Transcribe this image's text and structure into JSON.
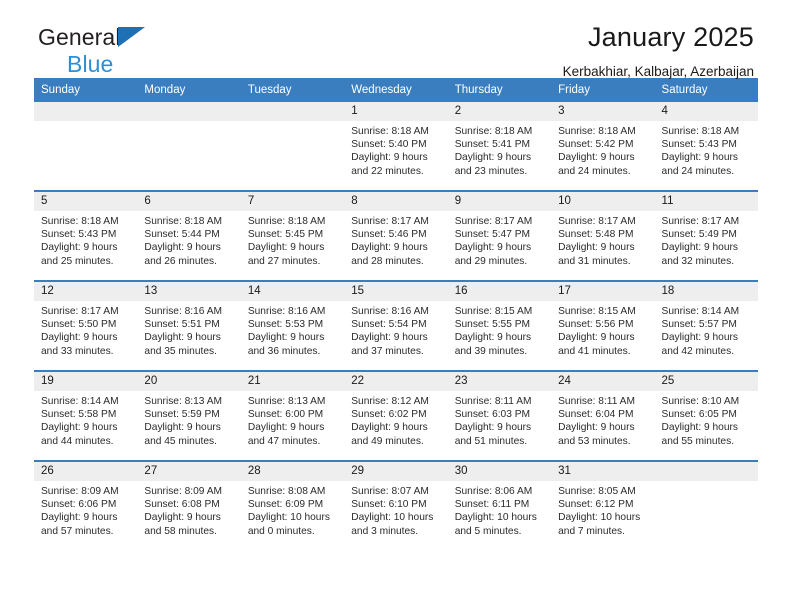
{
  "brand": {
    "line1": "General",
    "line2": "Blue",
    "logo_icon": "triangle-flag-icon"
  },
  "header": {
    "title": "January 2025",
    "subtitle": "Kerbakhiar, Kalbajar, Azerbaijan"
  },
  "colors": {
    "header_blue": "#3b7ebf",
    "brand_blue": "#2b8fd8",
    "daynum_band": "#eeeeee",
    "text": "#1a1a1a"
  },
  "calendar": {
    "weekday_headers": [
      "Sunday",
      "Monday",
      "Tuesday",
      "Wednesday",
      "Thursday",
      "Friday",
      "Saturday"
    ],
    "labels": {
      "sunrise": "Sunrise:",
      "sunset": "Sunset:",
      "daylight": "Daylight:"
    },
    "weeks": [
      [
        {
          "day": "",
          "sunrise": "",
          "sunset": "",
          "daylight_line1": "",
          "daylight_line2": ""
        },
        {
          "day": "",
          "sunrise": "",
          "sunset": "",
          "daylight_line1": "",
          "daylight_line2": ""
        },
        {
          "day": "",
          "sunrise": "",
          "sunset": "",
          "daylight_line1": "",
          "daylight_line2": ""
        },
        {
          "day": "1",
          "sunrise": "Sunrise: 8:18 AM",
          "sunset": "Sunset: 5:40 PM",
          "daylight_line1": "Daylight: 9 hours",
          "daylight_line2": "and 22 minutes."
        },
        {
          "day": "2",
          "sunrise": "Sunrise: 8:18 AM",
          "sunset": "Sunset: 5:41 PM",
          "daylight_line1": "Daylight: 9 hours",
          "daylight_line2": "and 23 minutes."
        },
        {
          "day": "3",
          "sunrise": "Sunrise: 8:18 AM",
          "sunset": "Sunset: 5:42 PM",
          "daylight_line1": "Daylight: 9 hours",
          "daylight_line2": "and 24 minutes."
        },
        {
          "day": "4",
          "sunrise": "Sunrise: 8:18 AM",
          "sunset": "Sunset: 5:43 PM",
          "daylight_line1": "Daylight: 9 hours",
          "daylight_line2": "and 24 minutes."
        }
      ],
      [
        {
          "day": "5",
          "sunrise": "Sunrise: 8:18 AM",
          "sunset": "Sunset: 5:43 PM",
          "daylight_line1": "Daylight: 9 hours",
          "daylight_line2": "and 25 minutes."
        },
        {
          "day": "6",
          "sunrise": "Sunrise: 8:18 AM",
          "sunset": "Sunset: 5:44 PM",
          "daylight_line1": "Daylight: 9 hours",
          "daylight_line2": "and 26 minutes."
        },
        {
          "day": "7",
          "sunrise": "Sunrise: 8:18 AM",
          "sunset": "Sunset: 5:45 PM",
          "daylight_line1": "Daylight: 9 hours",
          "daylight_line2": "and 27 minutes."
        },
        {
          "day": "8",
          "sunrise": "Sunrise: 8:17 AM",
          "sunset": "Sunset: 5:46 PM",
          "daylight_line1": "Daylight: 9 hours",
          "daylight_line2": "and 28 minutes."
        },
        {
          "day": "9",
          "sunrise": "Sunrise: 8:17 AM",
          "sunset": "Sunset: 5:47 PM",
          "daylight_line1": "Daylight: 9 hours",
          "daylight_line2": "and 29 minutes."
        },
        {
          "day": "10",
          "sunrise": "Sunrise: 8:17 AM",
          "sunset": "Sunset: 5:48 PM",
          "daylight_line1": "Daylight: 9 hours",
          "daylight_line2": "and 31 minutes."
        },
        {
          "day": "11",
          "sunrise": "Sunrise: 8:17 AM",
          "sunset": "Sunset: 5:49 PM",
          "daylight_line1": "Daylight: 9 hours",
          "daylight_line2": "and 32 minutes."
        }
      ],
      [
        {
          "day": "12",
          "sunrise": "Sunrise: 8:17 AM",
          "sunset": "Sunset: 5:50 PM",
          "daylight_line1": "Daylight: 9 hours",
          "daylight_line2": "and 33 minutes."
        },
        {
          "day": "13",
          "sunrise": "Sunrise: 8:16 AM",
          "sunset": "Sunset: 5:51 PM",
          "daylight_line1": "Daylight: 9 hours",
          "daylight_line2": "and 35 minutes."
        },
        {
          "day": "14",
          "sunrise": "Sunrise: 8:16 AM",
          "sunset": "Sunset: 5:53 PM",
          "daylight_line1": "Daylight: 9 hours",
          "daylight_line2": "and 36 minutes."
        },
        {
          "day": "15",
          "sunrise": "Sunrise: 8:16 AM",
          "sunset": "Sunset: 5:54 PM",
          "daylight_line1": "Daylight: 9 hours",
          "daylight_line2": "and 37 minutes."
        },
        {
          "day": "16",
          "sunrise": "Sunrise: 8:15 AM",
          "sunset": "Sunset: 5:55 PM",
          "daylight_line1": "Daylight: 9 hours",
          "daylight_line2": "and 39 minutes."
        },
        {
          "day": "17",
          "sunrise": "Sunrise: 8:15 AM",
          "sunset": "Sunset: 5:56 PM",
          "daylight_line1": "Daylight: 9 hours",
          "daylight_line2": "and 41 minutes."
        },
        {
          "day": "18",
          "sunrise": "Sunrise: 8:14 AM",
          "sunset": "Sunset: 5:57 PM",
          "daylight_line1": "Daylight: 9 hours",
          "daylight_line2": "and 42 minutes."
        }
      ],
      [
        {
          "day": "19",
          "sunrise": "Sunrise: 8:14 AM",
          "sunset": "Sunset: 5:58 PM",
          "daylight_line1": "Daylight: 9 hours",
          "daylight_line2": "and 44 minutes."
        },
        {
          "day": "20",
          "sunrise": "Sunrise: 8:13 AM",
          "sunset": "Sunset: 5:59 PM",
          "daylight_line1": "Daylight: 9 hours",
          "daylight_line2": "and 45 minutes."
        },
        {
          "day": "21",
          "sunrise": "Sunrise: 8:13 AM",
          "sunset": "Sunset: 6:00 PM",
          "daylight_line1": "Daylight: 9 hours",
          "daylight_line2": "and 47 minutes."
        },
        {
          "day": "22",
          "sunrise": "Sunrise: 8:12 AM",
          "sunset": "Sunset: 6:02 PM",
          "daylight_line1": "Daylight: 9 hours",
          "daylight_line2": "and 49 minutes."
        },
        {
          "day": "23",
          "sunrise": "Sunrise: 8:11 AM",
          "sunset": "Sunset: 6:03 PM",
          "daylight_line1": "Daylight: 9 hours",
          "daylight_line2": "and 51 minutes."
        },
        {
          "day": "24",
          "sunrise": "Sunrise: 8:11 AM",
          "sunset": "Sunset: 6:04 PM",
          "daylight_line1": "Daylight: 9 hours",
          "daylight_line2": "and 53 minutes."
        },
        {
          "day": "25",
          "sunrise": "Sunrise: 8:10 AM",
          "sunset": "Sunset: 6:05 PM",
          "daylight_line1": "Daylight: 9 hours",
          "daylight_line2": "and 55 minutes."
        }
      ],
      [
        {
          "day": "26",
          "sunrise": "Sunrise: 8:09 AM",
          "sunset": "Sunset: 6:06 PM",
          "daylight_line1": "Daylight: 9 hours",
          "daylight_line2": "and 57 minutes."
        },
        {
          "day": "27",
          "sunrise": "Sunrise: 8:09 AM",
          "sunset": "Sunset: 6:08 PM",
          "daylight_line1": "Daylight: 9 hours",
          "daylight_line2": "and 58 minutes."
        },
        {
          "day": "28",
          "sunrise": "Sunrise: 8:08 AM",
          "sunset": "Sunset: 6:09 PM",
          "daylight_line1": "Daylight: 10 hours",
          "daylight_line2": "and 0 minutes."
        },
        {
          "day": "29",
          "sunrise": "Sunrise: 8:07 AM",
          "sunset": "Sunset: 6:10 PM",
          "daylight_line1": "Daylight: 10 hours",
          "daylight_line2": "and 3 minutes."
        },
        {
          "day": "30",
          "sunrise": "Sunrise: 8:06 AM",
          "sunset": "Sunset: 6:11 PM",
          "daylight_line1": "Daylight: 10 hours",
          "daylight_line2": "and 5 minutes."
        },
        {
          "day": "31",
          "sunrise": "Sunrise: 8:05 AM",
          "sunset": "Sunset: 6:12 PM",
          "daylight_line1": "Daylight: 10 hours",
          "daylight_line2": "and 7 minutes."
        },
        {
          "day": "",
          "sunrise": "",
          "sunset": "",
          "daylight_line1": "",
          "daylight_line2": ""
        }
      ]
    ]
  }
}
